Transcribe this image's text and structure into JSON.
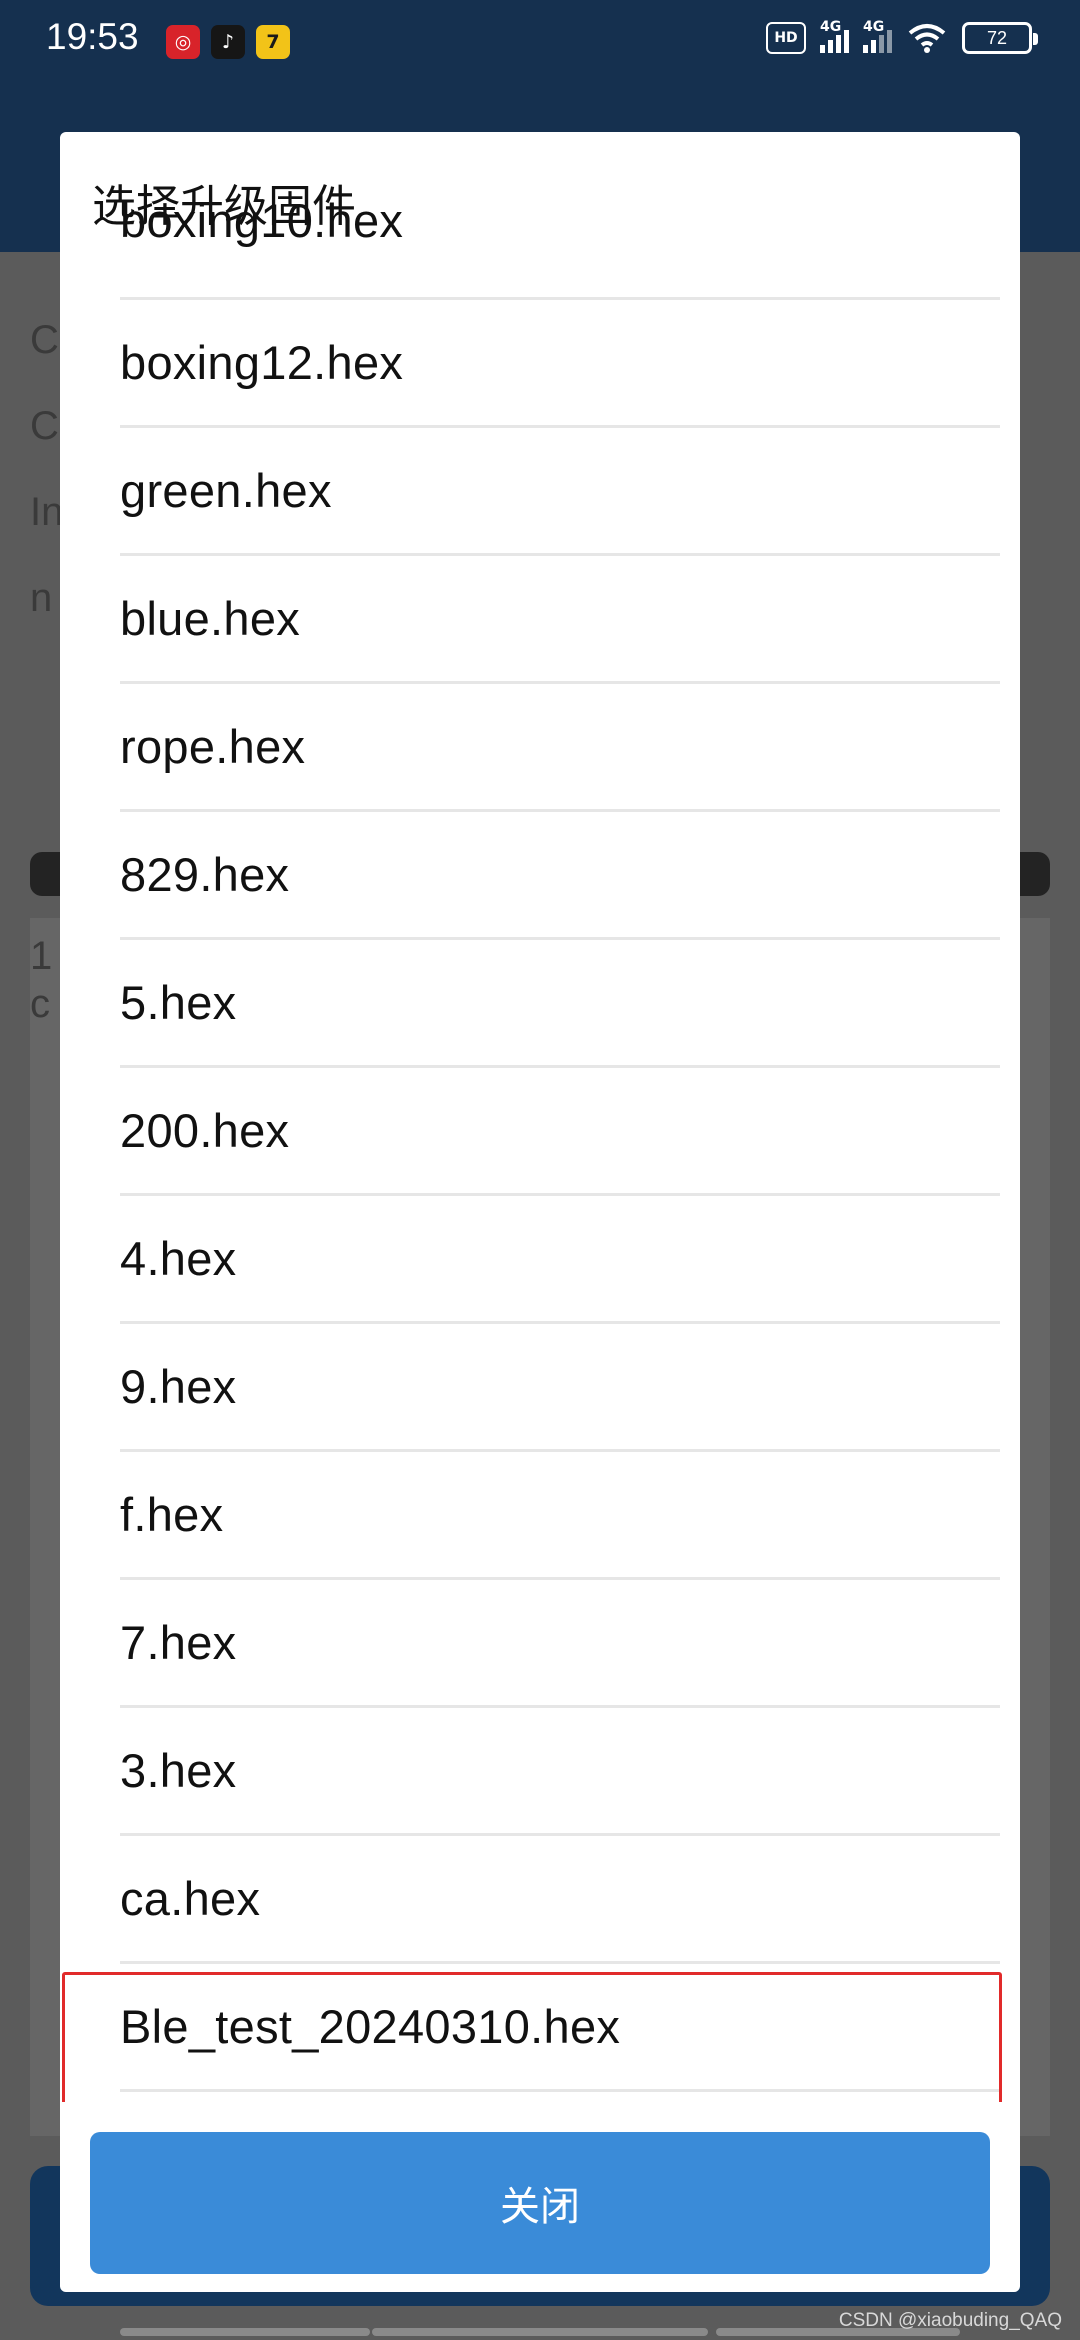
{
  "status_bar": {
    "time": "19:53",
    "battery": "72",
    "network_1": "4G",
    "network_2": "4G",
    "hd_label": "HD",
    "notification_icons": [
      "netease-music-icon",
      "tiktok-icon",
      "qimao-app-icon"
    ]
  },
  "background": {
    "rows": [
      "C",
      "C",
      "In",
      "n"
    ],
    "panel_lines": [
      "1",
      "c"
    ]
  },
  "dialog": {
    "title": "选择升级固件",
    "files": [
      "boxing10.hex",
      "boxing12.hex",
      "green.hex",
      "blue.hex",
      "rope.hex",
      "829.hex",
      "5.hex",
      "200.hex",
      "4.hex",
      "9.hex",
      "f.hex",
      "7.hex",
      "3.hex",
      "ca.hex",
      "Ble_test_20240310.hex"
    ],
    "highlighted_file": "Ble_test_20240310.hex",
    "highlight_color": "#e12a2a",
    "close_label": "关闭",
    "close_color": "#3a8bd8"
  },
  "watermark": "CSDN @xiaobuding_QAQ"
}
